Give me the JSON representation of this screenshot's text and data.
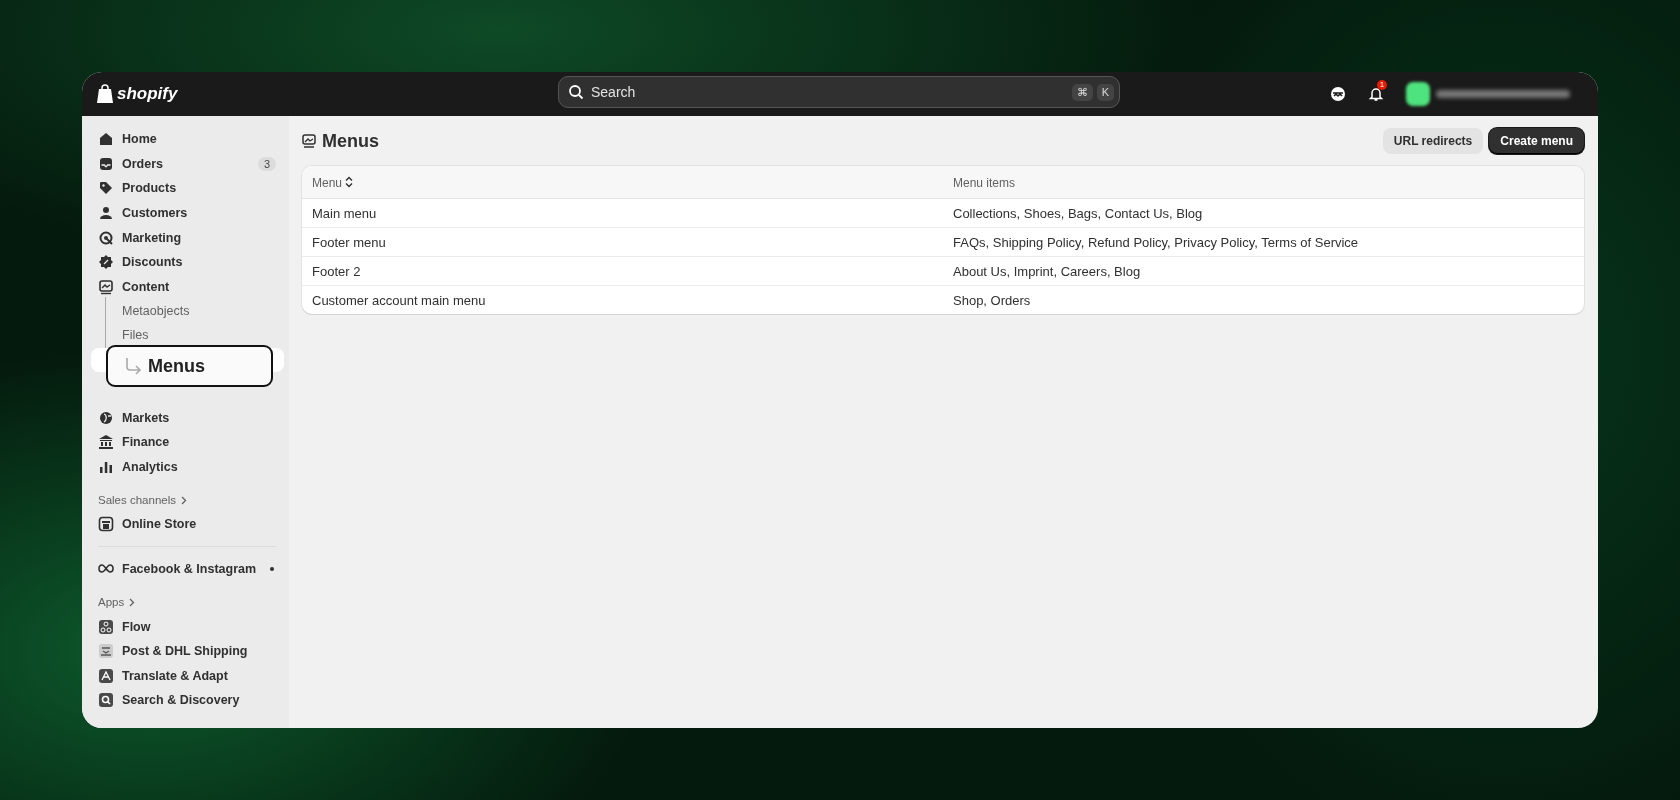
{
  "topbar": {
    "logo": "shopify",
    "search": {
      "placeholder": "Search",
      "shortcut": [
        "⌘",
        "K"
      ]
    },
    "notifications": {
      "badge": "1"
    }
  },
  "sidebar": {
    "items": [
      {
        "kind": "item",
        "label": "Home",
        "selected": false
      },
      {
        "kind": "item",
        "label": "Orders",
        "badge": "3",
        "selected": false
      },
      {
        "kind": "item",
        "label": "Products",
        "selected": false
      },
      {
        "kind": "item",
        "label": "Customers",
        "selected": false
      },
      {
        "kind": "item",
        "label": "Marketing",
        "selected": false
      },
      {
        "kind": "item",
        "label": "Discounts",
        "selected": false
      },
      {
        "kind": "item",
        "label": "Content",
        "selected": false,
        "expanded": true,
        "children": [
          {
            "label": "Metaobjects",
            "selected": false
          },
          {
            "label": "Files",
            "selected": false
          },
          {
            "label": "Menus",
            "selected": true
          }
        ]
      },
      {
        "kind": "item",
        "label": "Markets",
        "selected": false
      },
      {
        "kind": "item",
        "label": "Finance",
        "selected": false
      },
      {
        "kind": "item",
        "label": "Analytics",
        "selected": false
      },
      {
        "kind": "heading",
        "label": "Sales channels"
      },
      {
        "kind": "item",
        "label": "Online Store",
        "selected": false
      },
      {
        "kind": "divider"
      },
      {
        "kind": "item",
        "label": "Facebook & Instagram",
        "dot": true,
        "selected": false
      },
      {
        "kind": "heading",
        "label": "Apps"
      },
      {
        "kind": "item",
        "label": "Flow",
        "selected": false
      },
      {
        "kind": "item",
        "label": "Post & DHL Shipping",
        "selected": false
      },
      {
        "kind": "item",
        "label": "Translate & Adapt",
        "selected": false
      },
      {
        "kind": "item",
        "label": "Search & Discovery",
        "selected": false
      }
    ]
  },
  "page": {
    "title": "Menus",
    "buttons": [
      {
        "label": "URL redirects",
        "kind": "secondary"
      },
      {
        "label": "Create menu",
        "kind": "primary"
      }
    ]
  },
  "table": {
    "columns": [
      {
        "label": "Menu",
        "sortable": true
      },
      {
        "label": "Menu items",
        "sortable": false
      }
    ],
    "rows": [
      {
        "menu": "Main menu",
        "items": "Collections, Shoes, Bags, Contact Us, Blog"
      },
      {
        "menu": "Footer menu",
        "items": "FAQs, Shipping Policy, Refund Policy, Privacy Policy, Terms of Service"
      },
      {
        "menu": "Footer 2",
        "items": "About Us, Imprint, Careers, Blog"
      },
      {
        "menu": "Customer account main menu",
        "items": "Shop, Orders"
      }
    ]
  }
}
